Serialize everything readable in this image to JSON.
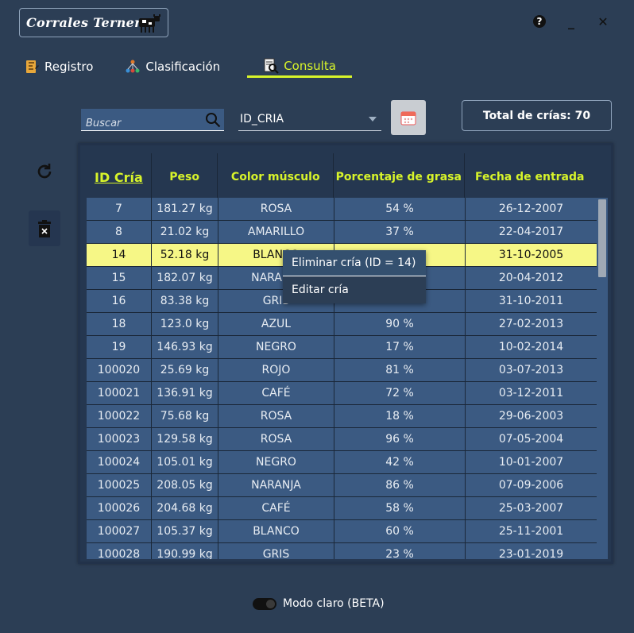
{
  "app": {
    "title": "Corrales Ternero",
    "help_label": "?",
    "minimize_label": "_",
    "close_label": "✕"
  },
  "tabs": [
    {
      "label": "Registro",
      "icon": "register-icon"
    },
    {
      "label": "Clasificación",
      "icon": "tree-icon"
    },
    {
      "label": "Consulta",
      "icon": "search-document-icon",
      "active": true
    }
  ],
  "toolbar": {
    "search_placeholder": "Buscar",
    "search_value": "",
    "filter_selected": "ID_CRIA",
    "total_label": "Total de crías: 70"
  },
  "table": {
    "columns": [
      "ID Cría",
      "Peso",
      "Color músculo",
      "Porcentaje de grasa",
      "Fecha de entrada"
    ],
    "sorted_column": 0,
    "selected_row": 2,
    "rows": [
      [
        "7",
        "181.27 kg",
        "ROSA",
        "54 %",
        "26-12-2007"
      ],
      [
        "8",
        "21.02 kg",
        "AMARILLO",
        "37 %",
        "22-04-2017"
      ],
      [
        "14",
        "52.18 kg",
        "BLANCO",
        "",
        "31-10-2005"
      ],
      [
        "15",
        "182.07 kg",
        "NARANJA",
        "",
        "20-04-2012"
      ],
      [
        "16",
        "83.38 kg",
        "GRIS",
        "",
        "31-10-2011"
      ],
      [
        "18",
        "123.0 kg",
        "AZUL",
        "90 %",
        "27-02-2013"
      ],
      [
        "19",
        "146.93 kg",
        "NEGRO",
        "17 %",
        "10-02-2014"
      ],
      [
        "100020",
        "25.69 kg",
        "ROJO",
        "81 %",
        "03-07-2013"
      ],
      [
        "100021",
        "136.91 kg",
        "CAFÉ",
        "72 %",
        "03-12-2011"
      ],
      [
        "100022",
        "75.68 kg",
        "ROSA",
        "18 %",
        "29-06-2003"
      ],
      [
        "100023",
        "129.58 kg",
        "ROSA",
        "96 %",
        "07-05-2004"
      ],
      [
        "100024",
        "105.01 kg",
        "NEGRO",
        "42 %",
        "10-01-2007"
      ],
      [
        "100025",
        "208.05 kg",
        "NARANJA",
        "86 %",
        "07-09-2006"
      ],
      [
        "100026",
        "204.68 kg",
        "CAFÉ",
        "58 %",
        "25-03-2007"
      ],
      [
        "100027",
        "105.37 kg",
        "BLANCO",
        "60 %",
        "25-11-2001"
      ],
      [
        "100028",
        "190.99 kg",
        "GRIS",
        "23 %",
        "23-01-2019"
      ]
    ]
  },
  "context_menu": {
    "items": [
      "Eliminar cría (ID = 14)",
      "Editar cría"
    ]
  },
  "footer": {
    "toggle_label": "Modo claro (BETA)"
  },
  "colors": {
    "background": "#2c3e55",
    "accent": "#d8f42a",
    "row": "#3b5a82",
    "selected_row": "#f6f786"
  }
}
